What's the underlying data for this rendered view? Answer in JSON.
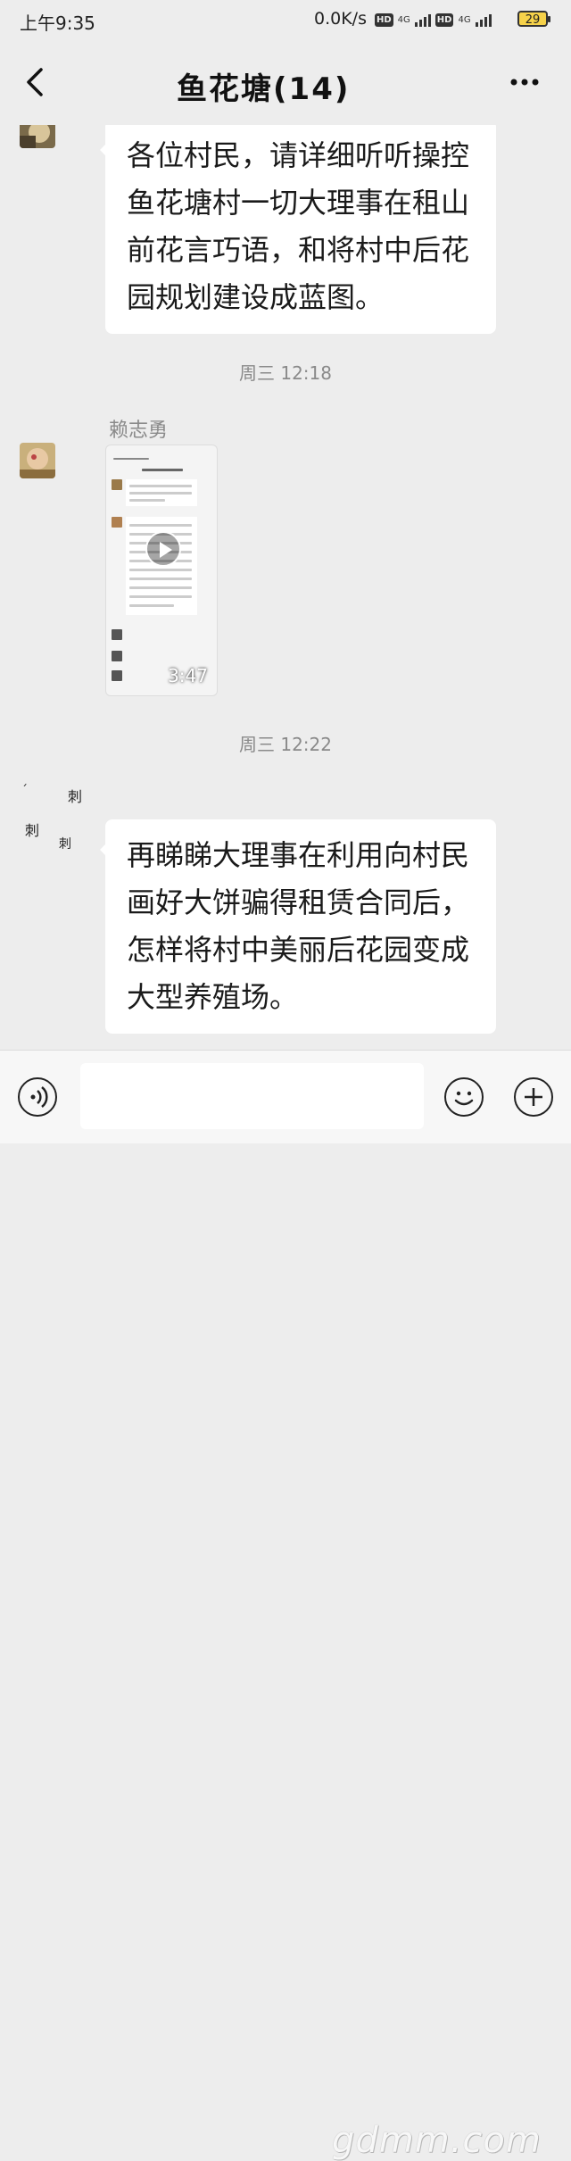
{
  "status_bar": {
    "time": "上午9:35",
    "network_speed": "0.0K/s",
    "hd_badge": "HD",
    "network_type": "4G",
    "battery": "29"
  },
  "header": {
    "title": "鱼花塘(14)"
  },
  "messages": [
    {
      "type": "text",
      "text": "各位村民，请详细听听操控鱼花塘村一切大理事在租山前花言巧语，和将村中后花园规划建设成蓝图。"
    },
    {
      "type": "time",
      "text": "周三 12:18"
    },
    {
      "type": "video",
      "sender": "赖志勇",
      "duration": "3:47"
    },
    {
      "type": "time",
      "text": "周三 12:22"
    },
    {
      "type": "text",
      "text": "再睇睇大理事在利用向村民画好大饼骗得租赁合同后，怎样将村中美丽后花园变成大型养殖场。"
    }
  ],
  "watermark": "gdmm.com",
  "colors": {
    "background": "#ededed",
    "bubble": "#ffffff",
    "time_text": "#8a8a8a"
  },
  "icons": [
    "back-arrow-icon",
    "more-icon",
    "voice-icon",
    "emoji-icon",
    "plus-icon",
    "play-icon"
  ]
}
